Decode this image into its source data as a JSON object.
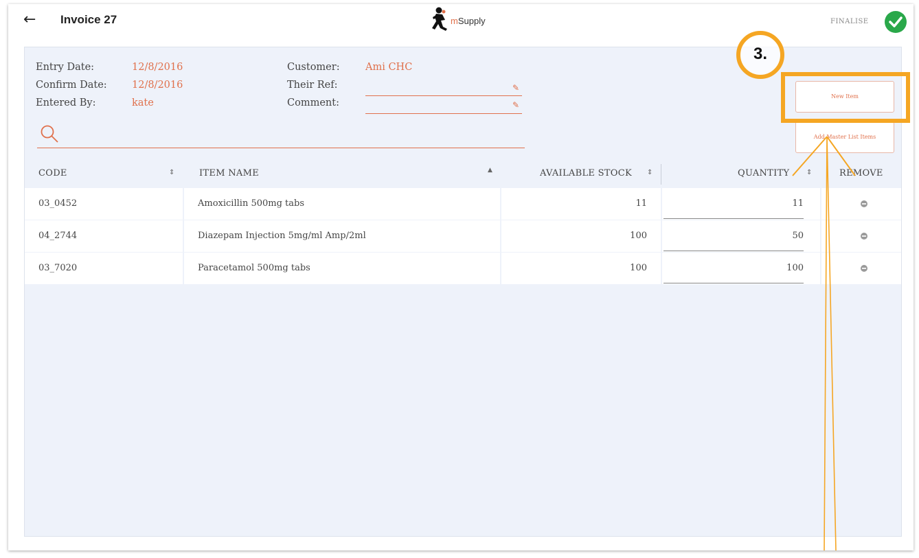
{
  "header": {
    "title": "Invoice 27",
    "logo_m": "m",
    "logo_rest": "Supply",
    "finalise_label": "FINALISE"
  },
  "meta": {
    "entry_date_label": "Entry Date:",
    "entry_date": "12/8/2016",
    "confirm_date_label": "Confirm Date:",
    "confirm_date": "12/8/2016",
    "entered_by_label": "Entered By:",
    "entered_by": "kate",
    "customer_label": "Customer:",
    "customer": "Ami CHC",
    "their_ref_label": "Their Ref:",
    "their_ref": "",
    "comment_label": "Comment:",
    "comment": ""
  },
  "search": {
    "value": ""
  },
  "buttons": {
    "new_item": "New Item",
    "add_master_list": "Add Master List Items"
  },
  "annotation": {
    "step": "3."
  },
  "table": {
    "columns": [
      "CODE",
      "ITEM NAME",
      "AVAILABLE STOCK",
      "QUANTITY",
      "REMOVE"
    ],
    "rows": [
      {
        "code": "03_0452",
        "name": "Amoxicillin 500mg tabs",
        "stock": "11",
        "quantity": "11"
      },
      {
        "code": "04_2744",
        "name": "Diazepam Injection 5mg/ml Amp/2ml",
        "stock": "100",
        "quantity": "50"
      },
      {
        "code": "03_7020",
        "name": "Paracetamol 500mg tabs",
        "stock": "100",
        "quantity": "100"
      }
    ]
  },
  "colors": {
    "accent": "#e0704b",
    "highlight": "#f5a623",
    "success": "#2aa84a",
    "panel_bg": "#eef2fa"
  }
}
